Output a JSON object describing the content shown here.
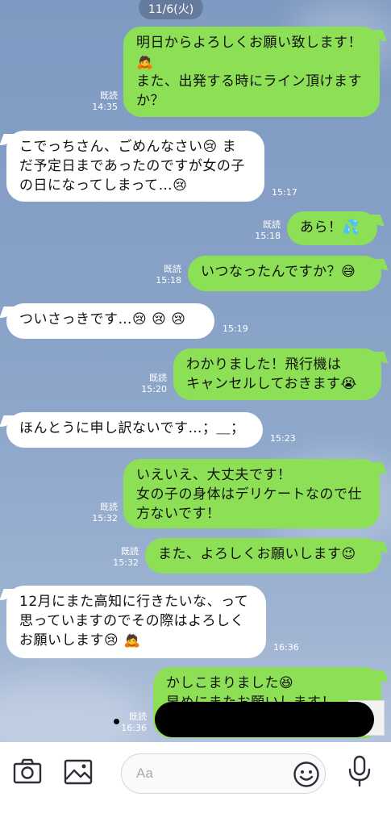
{
  "date_label": "11/6(火)",
  "read_label": "既読",
  "messages": [
    {
      "dir": "out",
      "lines": [
        "明日からよろしくお願い致します！",
        "🙇",
        "また、出発する時にライン頂けます",
        "か？"
      ],
      "time": "14:35",
      "read": true
    },
    {
      "dir": "in",
      "lines": [
        "こでっちさん、ごめんなさい😢 ま",
        "だ予定日まであったのですが女の子",
        "の日になってしまって…😢"
      ],
      "time": "15:17"
    },
    {
      "dir": "out",
      "lines": [
        "あら！💦"
      ],
      "time": "15:18",
      "read": true
    },
    {
      "dir": "out",
      "lines": [
        "いつなったんですか？😅"
      ],
      "time": "15:18",
      "read": true
    },
    {
      "dir": "in",
      "lines": [
        "ついさっきです…😢 😢 😢"
      ],
      "time": "15:19"
    },
    {
      "dir": "out",
      "lines": [
        "わかりました！飛行機は",
        "キャンセルしておきます😭"
      ],
      "time": "15:20",
      "read": true
    },
    {
      "dir": "in",
      "lines": [
        "ほんとうに申し訳ないです…；＿；"
      ],
      "time": "15:23"
    },
    {
      "dir": "out",
      "lines": [
        "いえいえ、大丈夫です！",
        "女の子の身体はデリケートなので仕",
        "方ないです！"
      ],
      "time": "15:32",
      "read": true
    },
    {
      "dir": "out",
      "lines": [
        "また、よろしくお願いします😉"
      ],
      "time": "15:32",
      "read": true
    },
    {
      "dir": "in",
      "lines": [
        "12月にまた高知に行きたいな、って",
        "思っていますのでその際はよろしく",
        "お願いします😢 🙇"
      ],
      "time": "16:36"
    },
    {
      "dir": "out",
      "lines": [
        "かしこまりました😆",
        "早めにまたお願いします！"
      ],
      "time": "16:36",
      "read": true
    }
  ],
  "input": {
    "placeholder": "Aa"
  },
  "icons": {
    "camera": "camera-icon",
    "image": "image-icon",
    "emoji": "emoji-icon",
    "mic": "microphone-icon"
  },
  "colors": {
    "outgoing_bubble": "#8de055",
    "incoming_bubble": "#ffffff",
    "chat_bg": "#86a0c6"
  }
}
